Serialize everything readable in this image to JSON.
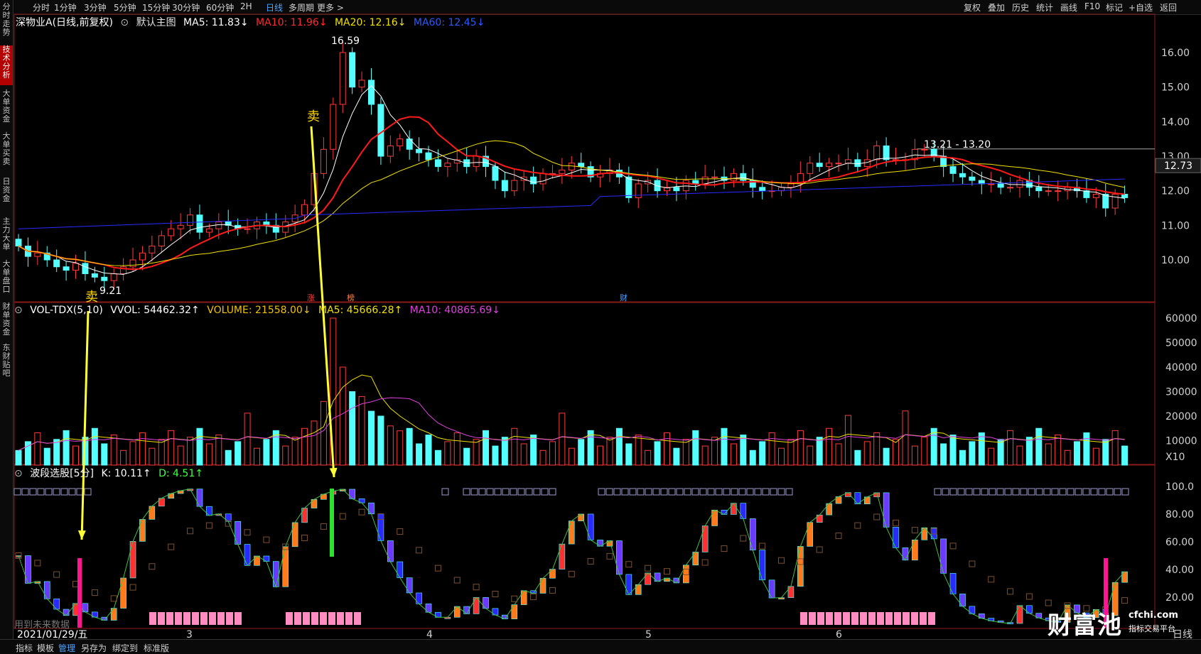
{
  "top_tabs": {
    "left": [
      "分时",
      "1分钟",
      "3分钟",
      "5分钟",
      "15分钟",
      "30分钟",
      "60分钟",
      "2H",
      "日线",
      "多周期",
      "更多 >"
    ],
    "active": "日线",
    "right": [
      "复权",
      "叠加",
      "历史",
      "统计",
      "画线",
      "F10",
      "标记",
      "+自选",
      "返回"
    ]
  },
  "left_tabs": {
    "items": [
      "分时走势",
      "技术分析",
      "大单资金",
      "大单买卖",
      "日资金",
      "主力大单",
      "大单盘口",
      "财单资金",
      "东财贴吧"
    ],
    "active": "技术分析"
  },
  "main_legend": {
    "stock": "深物业A(日线,前复权)",
    "template": "默认主图",
    "ma5": "MA5: 11.83↓",
    "ma10": "MA10: 11.96↓",
    "ma20": "MA20: 12.16↓",
    "ma60": "MA60: 12.45↓"
  },
  "price_axis": {
    "ticks": [
      "16.00",
      "15.00",
      "14.00",
      "13.00",
      "12.00",
      "11.00",
      "10.00"
    ],
    "current": "12.73"
  },
  "annotations": {
    "high": "16.59",
    "low": "9.21",
    "range": "13.21 - 13.20",
    "sell1": "卖",
    "sell2": "卖",
    "m1": "涨",
    "m2": "榜",
    "m3": "财"
  },
  "vol_legend": {
    "name": "VOL-TDX(5,10)",
    "vvol": "VVOL: 54462.32↑",
    "volume": "VOLUME: 21558.00↓",
    "ma5": "MA5: 45666.28↑",
    "ma10": "MA10: 40865.69↓"
  },
  "vol_axis": {
    "ticks": [
      "60000",
      "50000",
      "40000",
      "30000",
      "20000",
      "10000"
    ],
    "unit": "X10"
  },
  "ind_legend": {
    "name": "波段选股[5分]",
    "k": "K: 10.11↑",
    "d": "D: 4.51↑"
  },
  "ind_axis": {
    "ticks": [
      "100.0",
      "80.00",
      "60.00",
      "40.00",
      "20.00"
    ]
  },
  "x_axis": {
    "date": "2021/01/29/五",
    "months": [
      "3",
      "4",
      "5",
      "6"
    ],
    "extra": "日线",
    "watermark": "用到未来数据"
  },
  "bottom_tabs": {
    "items": [
      "指标",
      "模板",
      "管理",
      "另存为",
      "绑定到",
      "标准版"
    ],
    "active": "管理"
  },
  "logo": {
    "name": "财富池",
    "url": "cfchi.com",
    "slogan": "指标交易平台"
  },
  "colors": {
    "up": "#ff3b3b",
    "down": "#54ffff",
    "ma5": "#ffffff",
    "ma10": "#ff1a1a",
    "ma20": "#f0e000",
    "ma60": "#2a2aff",
    "arrow": "#ffff33"
  },
  "chart_data": {
    "type": "candlestick",
    "closes": [
      10.4,
      10.1,
      10.2,
      10.0,
      9.8,
      9.7,
      9.9,
      9.6,
      9.5,
      9.4,
      9.6,
      9.8,
      10.0,
      10.2,
      10.4,
      10.7,
      10.9,
      11.0,
      11.3,
      10.8,
      10.9,
      11.1,
      11.0,
      10.9,
      10.9,
      11.1,
      11.0,
      10.8,
      11.1,
      11.3,
      11.6,
      12.5,
      13.2,
      14.5,
      16.0,
      15.0,
      15.2,
      14.5,
      13.0,
      13.3,
      13.5,
      13.2,
      13.1,
      12.9,
      12.7,
      12.8,
      12.9,
      12.7,
      13.0,
      12.7,
      12.3,
      12.0,
      12.3,
      12.4,
      12.2,
      12.5,
      12.5,
      12.6,
      12.8,
      12.7,
      12.4,
      12.5,
      12.6,
      12.4,
      11.8,
      12.2,
      12.3,
      12.0,
      12.1,
      12.0,
      12.3,
      12.2,
      12.4,
      12.4,
      12.3,
      12.5,
      12.3,
      12.1,
      12.0,
      12.0,
      12.1,
      12.2,
      12.5,
      12.8,
      12.7,
      12.8,
      12.8,
      12.9,
      12.7,
      12.9,
      13.3,
      12.9,
      12.9,
      12.9,
      13.2,
      13.2,
      13.0,
      12.7,
      12.5,
      12.4,
      12.3,
      12.2,
      12.2,
      12.1,
      12.1,
      12.3,
      12.1,
      12.0,
      12.0,
      12.0,
      12.1,
      12.0,
      11.8,
      11.9,
      11.5,
      11.9,
      11.8
    ],
    "volume_scale": "X10",
    "month_labels": [
      "3",
      "4",
      "5",
      "6"
    ]
  }
}
